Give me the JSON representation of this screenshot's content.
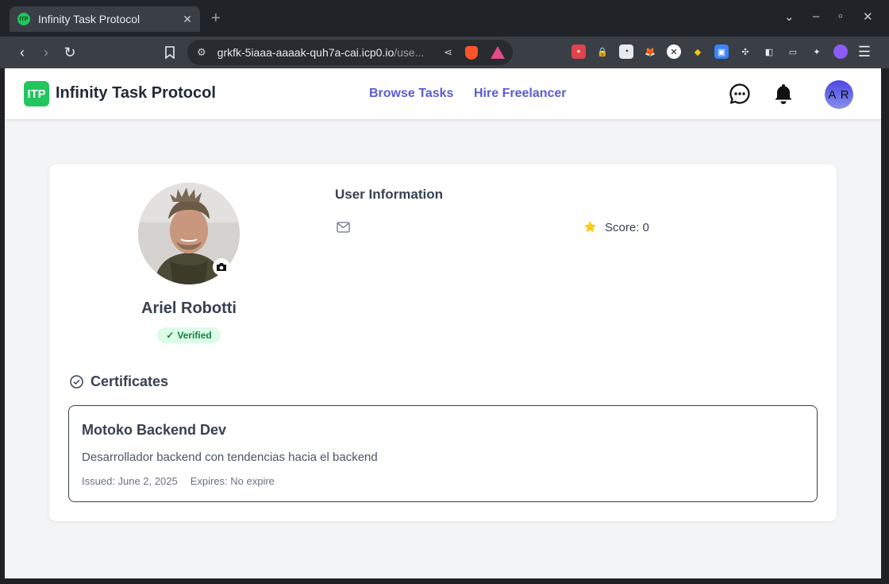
{
  "browser": {
    "tab_title": "Infinity Task Protocol",
    "favicon_text": "ITP",
    "new_tab": "+",
    "url_host": "grkfk-5iaaa-aaaak-quh7a-cai.icp0.io",
    "url_path": "/use..."
  },
  "nav": {
    "logo_badge": "ITP",
    "logo_text": "Infinity Task Protocol",
    "links": [
      "Browse Tasks",
      "Hire Freelancer"
    ],
    "avatar_initials": "A R"
  },
  "profile": {
    "name": "Ariel Robotti",
    "verified_label": "Verified",
    "info_title": "User Information",
    "score_label": "Score: 0"
  },
  "certificates": {
    "heading": "Certificates",
    "items": [
      {
        "name": "Motoko Backend Dev",
        "description": "Desarrollador backend con tendencias hacia el backend",
        "issued": "Issued: June 2, 2025",
        "expires": "Expires: No expire"
      }
    ]
  },
  "colors": {
    "brand_green": "#22c55e",
    "link_purple": "#5b5bd6",
    "star_yellow": "#facc15",
    "verified_bg": "#dcfce7"
  }
}
